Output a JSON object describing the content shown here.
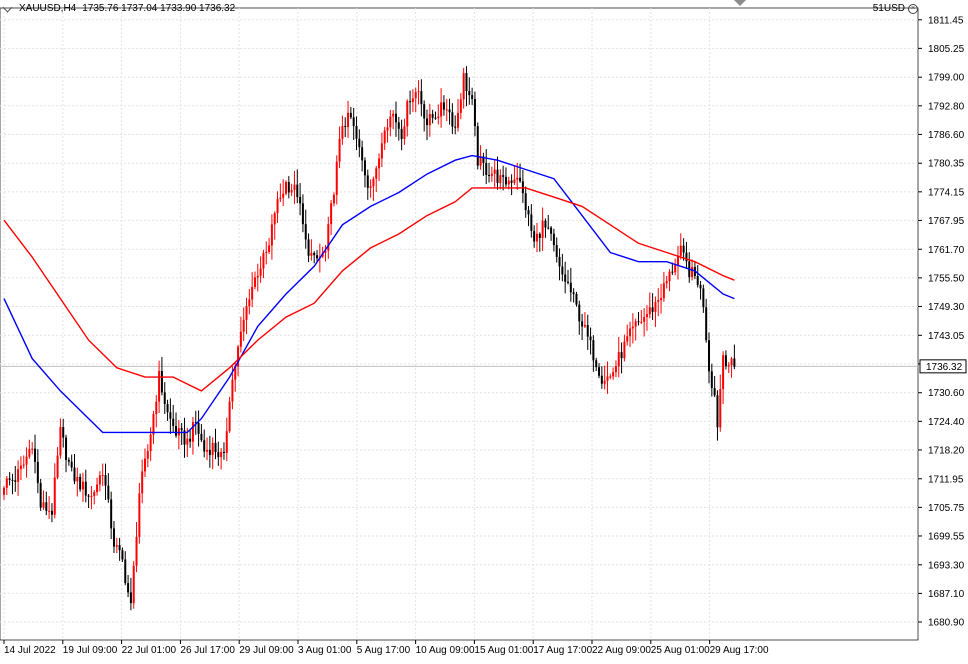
{
  "header": {
    "symbol": "XAUUSD,H4",
    "ohlc": "1735.76 1737.04 1733.90 1736.32"
  },
  "top_right": {
    "label": "51USD",
    "close_icon": "close-circle-icon"
  },
  "colors": {
    "bull": "#ff0000",
    "bear": "#000000",
    "ma_fast": "#0000ff",
    "ma_slow": "#ff0000",
    "grid": "#e3e3e3",
    "price_line": "#c0c0c0"
  },
  "chart_data": {
    "type": "candlestick",
    "title": "",
    "xlabel": "",
    "ylabel": "",
    "ylim": [
      1677.0,
      1814.0
    ],
    "grid": true,
    "y_ticks": [
      1811.45,
      1805.25,
      1799.0,
      1792.8,
      1786.6,
      1780.35,
      1774.15,
      1767.95,
      1761.7,
      1755.5,
      1749.3,
      1743.05,
      1736.85,
      1730.6,
      1724.4,
      1718.2,
      1711.95,
      1705.75,
      1699.55,
      1693.3,
      1687.1,
      1680.9
    ],
    "x_tick_labels": [
      "14 Jul 2022",
      "19 Jul 09:00",
      "22 Jul 01:00",
      "26 Jul 17:00",
      "29 Jul 09:00",
      "3 Aug 01:00",
      "5 Aug 17:00",
      "10 Aug 09:00",
      "15 Aug 01:00",
      "17 Aug 17:00",
      "22 Aug 09:00",
      "25 Aug 01:00",
      "29 Aug 17:00"
    ],
    "current_price": "1736.32",
    "anchors": [
      [
        0,
        1711
      ],
      [
        4,
        1712
      ],
      [
        7,
        1715
      ],
      [
        10,
        1720
      ],
      [
        13,
        1706
      ],
      [
        17,
        1705
      ],
      [
        20,
        1722
      ],
      [
        24,
        1713
      ],
      [
        28,
        1710
      ],
      [
        31,
        1708
      ],
      [
        35,
        1714
      ],
      [
        39,
        1698
      ],
      [
        42,
        1694
      ],
      [
        45,
        1684
      ],
      [
        48,
        1709
      ],
      [
        51,
        1718
      ],
      [
        55,
        1734
      ],
      [
        58,
        1726
      ],
      [
        61,
        1722
      ],
      [
        65,
        1720
      ],
      [
        68,
        1724
      ],
      [
        71,
        1718
      ],
      [
        74,
        1719
      ],
      [
        78,
        1716
      ],
      [
        80,
        1730
      ],
      [
        83,
        1740
      ],
      [
        87,
        1752
      ],
      [
        90,
        1757
      ],
      [
        94,
        1762
      ],
      [
        96,
        1770
      ],
      [
        100,
        1776
      ],
      [
        104,
        1774
      ],
      [
        107,
        1763
      ],
      [
        110,
        1759
      ],
      [
        114,
        1761
      ],
      [
        117,
        1775
      ],
      [
        120,
        1789
      ],
      [
        123,
        1790
      ],
      [
        126,
        1783
      ],
      [
        129,
        1776
      ],
      [
        132,
        1778
      ],
      [
        135,
        1789
      ],
      [
        138,
        1791
      ],
      [
        141,
        1787
      ],
      [
        144,
        1795
      ],
      [
        147,
        1796
      ],
      [
        150,
        1789
      ],
      [
        153,
        1791
      ],
      [
        157,
        1793
      ],
      [
        160,
        1788
      ],
      [
        163,
        1799
      ],
      [
        166,
        1793
      ],
      [
        168,
        1781
      ],
      [
        171,
        1779
      ],
      [
        174,
        1778
      ],
      [
        177,
        1776
      ],
      [
        180,
        1777
      ],
      [
        182,
        1778
      ],
      [
        185,
        1771
      ],
      [
        188,
        1763
      ],
      [
        191,
        1767
      ],
      [
        194,
        1764
      ],
      [
        197,
        1757
      ],
      [
        200,
        1754
      ],
      [
        203,
        1749
      ],
      [
        206,
        1744
      ],
      [
        209,
        1739
      ],
      [
        212,
        1734
      ],
      [
        215,
        1734
      ],
      [
        218,
        1738
      ],
      [
        221,
        1742
      ],
      [
        224,
        1745
      ],
      [
        227,
        1747
      ],
      [
        230,
        1749
      ],
      [
        233,
        1752
      ],
      [
        236,
        1756
      ],
      [
        238,
        1759
      ],
      [
        240,
        1761
      ],
      [
        243,
        1757
      ],
      [
        246,
        1755
      ],
      [
        248,
        1750
      ],
      [
        250,
        1736
      ],
      [
        252,
        1730
      ],
      [
        253,
        1724
      ],
      [
        255,
        1739
      ],
      [
        257,
        1737
      ],
      [
        259,
        1736
      ]
    ],
    "series": [
      {
        "type": "line",
        "color": "#0000ff",
        "points": [
          [
            0,
            1751
          ],
          [
            10,
            1738
          ],
          [
            20,
            1731
          ],
          [
            30,
            1725
          ],
          [
            35,
            1722
          ],
          [
            45,
            1722
          ],
          [
            60,
            1722
          ],
          [
            65,
            1722
          ],
          [
            70,
            1725
          ],
          [
            80,
            1734
          ],
          [
            90,
            1745
          ],
          [
            100,
            1752
          ],
          [
            110,
            1758
          ],
          [
            120,
            1767
          ],
          [
            130,
            1771
          ],
          [
            140,
            1774
          ],
          [
            150,
            1778
          ],
          [
            160,
            1781
          ],
          [
            166,
            1782
          ],
          [
            175,
            1781
          ],
          [
            185,
            1779
          ],
          [
            195,
            1777
          ],
          [
            205,
            1769
          ],
          [
            215,
            1761
          ],
          [
            225,
            1759
          ],
          [
            235,
            1759
          ],
          [
            245,
            1757
          ],
          [
            255,
            1752
          ],
          [
            259,
            1751
          ]
        ]
      },
      {
        "type": "line",
        "color": "#ff0000",
        "points": [
          [
            0,
            1768
          ],
          [
            10,
            1760
          ],
          [
            20,
            1751
          ],
          [
            30,
            1742
          ],
          [
            40,
            1736
          ],
          [
            50,
            1734
          ],
          [
            60,
            1734
          ],
          [
            70,
            1731
          ],
          [
            80,
            1736
          ],
          [
            90,
            1742
          ],
          [
            100,
            1747
          ],
          [
            110,
            1750
          ],
          [
            120,
            1757
          ],
          [
            130,
            1762
          ],
          [
            140,
            1765
          ],
          [
            150,
            1769
          ],
          [
            160,
            1772
          ],
          [
            166,
            1775
          ],
          [
            175,
            1775
          ],
          [
            185,
            1775
          ],
          [
            195,
            1773
          ],
          [
            205,
            1771
          ],
          [
            215,
            1767
          ],
          [
            225,
            1763
          ],
          [
            235,
            1761
          ],
          [
            245,
            1759
          ],
          [
            255,
            1756
          ],
          [
            259,
            1755
          ]
        ]
      }
    ]
  }
}
